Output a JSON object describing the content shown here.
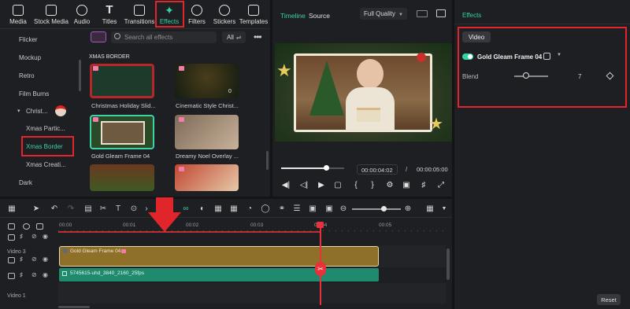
{
  "toolbar": {
    "items": [
      {
        "label": "Media",
        "icon": "media-icon"
      },
      {
        "label": "Stock Media",
        "icon": "stock-media-icon"
      },
      {
        "label": "Audio",
        "icon": "audio-icon"
      },
      {
        "label": "Titles",
        "icon": "titles-icon"
      },
      {
        "label": "Transitions",
        "icon": "transitions-icon"
      },
      {
        "label": "Effects",
        "icon": "effects-icon"
      },
      {
        "label": "Filters",
        "icon": "filters-icon"
      },
      {
        "label": "Stickers",
        "icon": "stickers-icon"
      },
      {
        "label": "Templates",
        "icon": "templates-icon"
      }
    ]
  },
  "sidebar": {
    "items": [
      "Flicker",
      "Mockup",
      "Retro",
      "Film Burns",
      "Christ...",
      "Xmas Partic...",
      "Xmas Border",
      "Xmas Creati...",
      "Dark"
    ]
  },
  "library": {
    "search_placeholder": "Search all effects",
    "filter_label": "All",
    "section_title": "XMAS BORDER",
    "items": [
      "Christmas Holiday Slid...",
      "Cinematic Style Christ...",
      "Gold Gleam Frame 04",
      "Dreamy Noel Overlay ..."
    ],
    "badge_count": "0"
  },
  "player": {
    "tab_timeline": "Timeline",
    "tab_source": "Source",
    "quality": "Full Quality",
    "current_time": "00:00:04:02",
    "separator": "/",
    "total_time": "00:00:05:00",
    "progress": 0.8
  },
  "effects_panel": {
    "title": "Effects",
    "tab": "Video",
    "effect_name": "Gold Gleam Frame 04",
    "blend_label": "Blend",
    "blend_value": "7",
    "reset_label": "Reset"
  },
  "timeline": {
    "ruler": [
      "00:00",
      "00:01",
      "00:02",
      "00:03",
      "00:04",
      "00:05"
    ],
    "tracks": [
      "Video 3",
      "Video 1"
    ],
    "clip_effect": "Gold Gleam Frame 04",
    "clip_video": "5745615-uhd_3840_2160_25fps",
    "playhead_time_fraction": 0.8,
    "colors": {
      "effect_clip": "#8e7028",
      "video_clip": "#1f8a6d",
      "playhead": "#e8313a",
      "accent": "#36d2a6",
      "highlight": "#e0262a"
    }
  }
}
